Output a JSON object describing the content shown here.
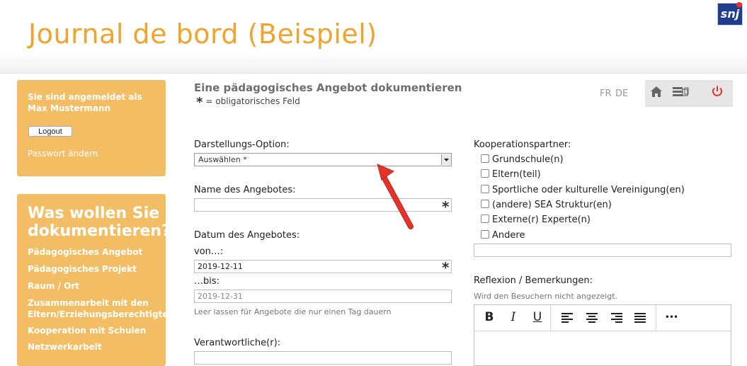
{
  "header": {
    "title": "Journal de bord (Beispiel)",
    "logo_text": "snj"
  },
  "sidebar": {
    "login_text": "Sie sind angemeldet als Max Mustermann",
    "logout_label": "Logout",
    "password_link": "Passwort ändern",
    "menu_title": "Was wollen Sie dokumentieren?",
    "menu_items": [
      "Pädagogisches Angebot",
      "Pädagogisches Projekt",
      "Raum / Ort",
      "Zusammenarbeit mit den Eltern/Erziehungsberechtigten",
      "Kooperation mit Schulen",
      "Netzwerkarbeit"
    ]
  },
  "main": {
    "title": "Eine pädagogisches Angebot dokumentieren",
    "required_symbol": "*",
    "required_note": "= obligatorisches Feld",
    "lang": {
      "fr": "FR",
      "de": "DE"
    },
    "display_option": {
      "label": "Darstellungs-Option:",
      "value": "Auswählen *"
    },
    "name": {
      "label": "Name des Angebotes:",
      "value": ""
    },
    "date": {
      "label": "Datum des Angebotes:",
      "from_label": "von…:",
      "from_value": "2019-12-11",
      "to_label": "…bis:",
      "to_placeholder": "2019-12-31",
      "hint": "Leer lassen für Angebote die nur einen Tag dauern"
    },
    "responsible": {
      "label": "Verantwortliche(r):",
      "value": ""
    },
    "cooperation": {
      "label": "Kooperationspartner:",
      "options": [
        "Grundschule(n)",
        "Eltern(teil)",
        "Sportliche oder kulturelle Vereinigung(en)",
        "(andere) SEA Struktur(en)",
        "Externe(r) Experte(n)",
        "Andere"
      ]
    },
    "reflection": {
      "label": "Reflexion / Bemerkungen:",
      "hint": "Wird den Besuchern nicht angezeigt."
    }
  },
  "editor_buttons": {
    "bold": "B",
    "italic": "I",
    "underline": "U",
    "more": "•••"
  },
  "colors": {
    "accent": "#f0a32d",
    "panel": "#f3bd64",
    "arrow": "#e5332a",
    "logout_icon": "#e0332e"
  }
}
